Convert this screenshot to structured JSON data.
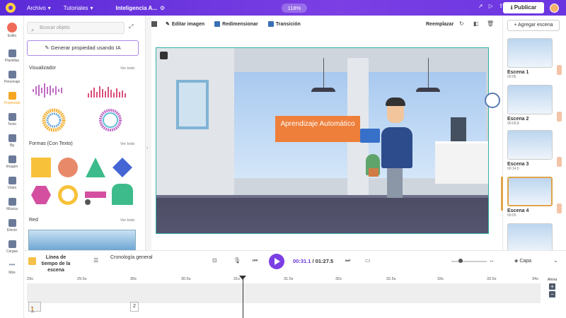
{
  "topbar": {
    "menu_file": "Archivo",
    "menu_tutorials": "Tutoriales",
    "project_name": "Inteligencia A...",
    "zoom": "118%",
    "publish_label": "Publicar"
  },
  "leftnav": {
    "items": [
      "Estilo",
      "Plantillas",
      "Personaje",
      "Propiedad",
      "Texto",
      "Bg",
      "Imagen",
      "Video",
      "Música",
      "Efecto",
      "Cargas",
      "Más"
    ]
  },
  "panel": {
    "search_placeholder": "Buscar objeto",
    "generate_label": "Generar propiedad usando IA",
    "section_visualizer": "Visualizador",
    "section_shapes": "Formas (Con Texto)",
    "section_net": "Red",
    "see_all": "Ver todo"
  },
  "toolbar": {
    "edit_image": "Editar imagen",
    "resize": "Redimensionar",
    "transition": "Transición",
    "replace": "Reemplazar"
  },
  "stage": {
    "sign_text": "Aprendizaje Automático"
  },
  "scenes": {
    "add_label": "+ Agregar escena",
    "list": [
      {
        "name": "Escena 1",
        "time": "00:05"
      },
      {
        "name": "Escena 2",
        "time": "00:09.8"
      },
      {
        "name": "Escena 3",
        "time": "00:14.5"
      },
      {
        "name": "Escena 4",
        "time": "00:05"
      }
    ]
  },
  "timeline": {
    "scene_timeline": "Línea de tiempo de la escena",
    "general_chronology": "Cronología general",
    "current_time": "00:31.1",
    "total_time": "/ 01:27.5",
    "layer_label": "Capa",
    "ahora": "Ahora",
    "layer_count": "2",
    "ticks": [
      "29s",
      "29.5s",
      "30s",
      "30.5s",
      "31s",
      "31.5s",
      "32s",
      "32.5s",
      "33s",
      "33.5s",
      "34s"
    ]
  }
}
